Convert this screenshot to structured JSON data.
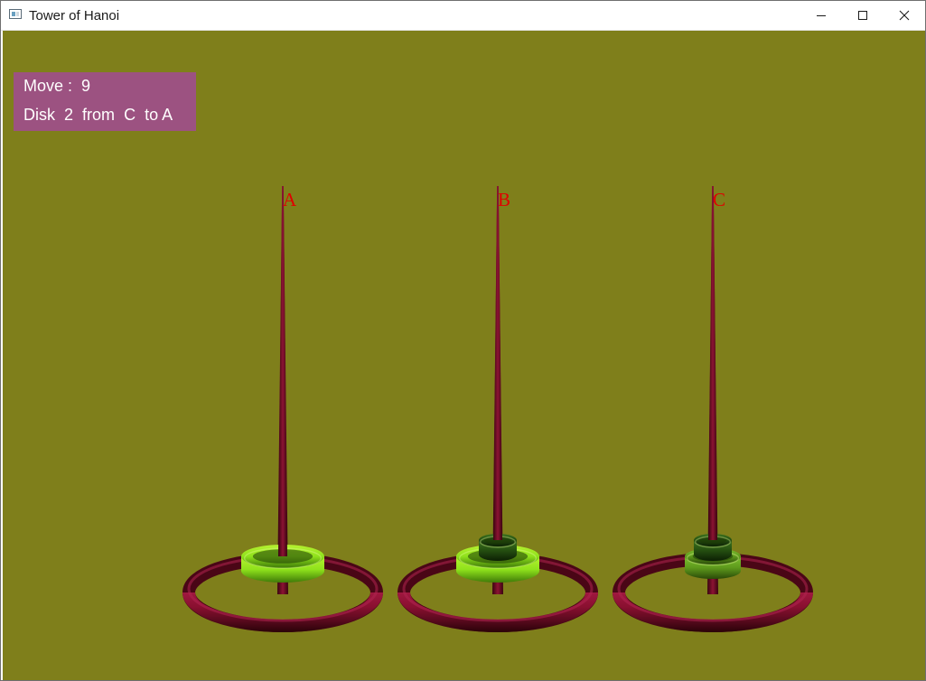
{
  "window": {
    "title": "Tower of Hanoi",
    "icon": "application-window-icon",
    "controls": [
      "minimize-icon",
      "maximize-icon",
      "close-icon"
    ]
  },
  "hud": {
    "move_label": "Move :",
    "move_value": "9",
    "disk_word": "Disk",
    "disk_number": "2",
    "from_word": "from",
    "from_peg": "C",
    "to_word": "to",
    "to_peg": "A"
  },
  "pegs": [
    {
      "label": "A",
      "disks_bottom_to_top": [
        1
      ]
    },
    {
      "label": "B",
      "disks_bottom_to_top": [
        1,
        3
      ]
    },
    {
      "label": "C",
      "disks_bottom_to_top": [
        2,
        3
      ]
    }
  ],
  "colors": {
    "background": "#7f7f1b",
    "hud_background": "#9c5281",
    "peg_label": "#e00000",
    "base_ring": "#8a1030",
    "peg_spike": "#6e0c26",
    "disk_large": "#8fe21c",
    "disk_medium": "#5e9a1c",
    "disk_small": "#244e10"
  }
}
